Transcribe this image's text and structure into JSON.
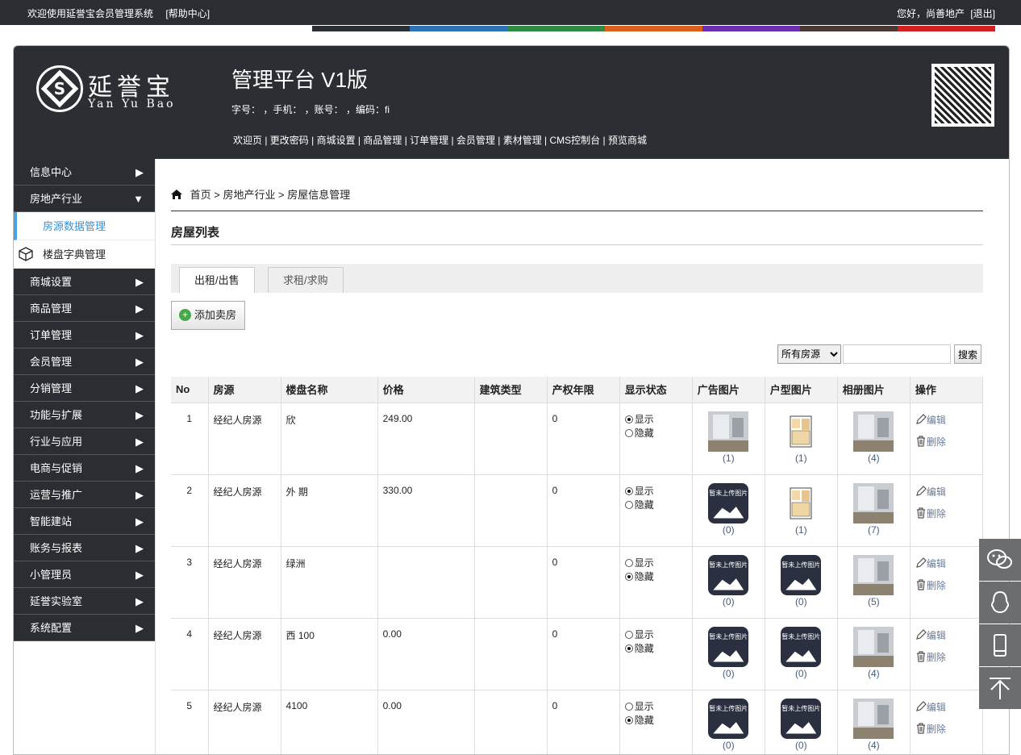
{
  "topbar": {
    "welcome": "欢迎使用延誉宝会员管理系统",
    "help": "[帮助中心]",
    "greeting": "您好，尚善地产",
    "logout": "[退出]"
  },
  "colorbar": [
    "#2a2e33",
    "#2d72b5",
    "#2f8a44",
    "#d9601a",
    "#6b2fb0",
    "#4a3a34",
    "#d32020"
  ],
  "header": {
    "logo_cn": "延誉宝",
    "logo_en": "Yan Yu Bao",
    "title": "管理平台  V1版",
    "info": "字号：       ，手机：          ，账号：                  ，编码：fi",
    "nav": "欢迎页 | 更改密码 | 商城设置 | 商品管理 | 订单管理 | 会员管理 | 素材管理 | CMS控制台 | 预览商城"
  },
  "sidebar": {
    "items": [
      {
        "label": "信息中心",
        "type": "menu",
        "arrow": "▶"
      },
      {
        "label": "房地产行业",
        "type": "menu",
        "arrow": "▼"
      },
      {
        "label": "房源数据管理",
        "type": "sub-active"
      },
      {
        "label": "楼盘字典管理",
        "type": "sub"
      },
      {
        "label": "商城设置",
        "type": "menu",
        "arrow": "▶"
      },
      {
        "label": "商品管理",
        "type": "menu",
        "arrow": "▶"
      },
      {
        "label": "订单管理",
        "type": "menu",
        "arrow": "▶"
      },
      {
        "label": "会员管理",
        "type": "menu",
        "arrow": "▶"
      },
      {
        "label": "分销管理",
        "type": "menu",
        "arrow": "▶"
      },
      {
        "label": "功能与扩展",
        "type": "menu",
        "arrow": "▶"
      },
      {
        "label": "行业与应用",
        "type": "menu",
        "arrow": "▶"
      },
      {
        "label": "电商与促销",
        "type": "menu",
        "arrow": "▶"
      },
      {
        "label": "运营与推广",
        "type": "menu",
        "arrow": "▶"
      },
      {
        "label": "智能建站",
        "type": "menu",
        "arrow": "▶"
      },
      {
        "label": "账务与报表",
        "type": "menu",
        "arrow": "▶"
      },
      {
        "label": "小管理员",
        "type": "menu",
        "arrow": "▶"
      },
      {
        "label": "延誉实验室",
        "type": "menu",
        "arrow": "▶"
      },
      {
        "label": "系统配置",
        "type": "menu",
        "arrow": "▶"
      }
    ]
  },
  "breadcrumb": "首页 > 房地产行业 > 房屋信息管理",
  "list_title": "房屋列表",
  "tabs": [
    "出租/出售",
    "求租/求购"
  ],
  "add_button": "添加卖房",
  "filter": {
    "select": "所有房源",
    "search_button": "搜索"
  },
  "table": {
    "headers": [
      "No",
      "房源",
      "楼盘名称",
      "价格",
      "建筑类型",
      "产权年限",
      "显示状态",
      "广告图片",
      "户型图片",
      "相册图片",
      "操作"
    ],
    "show_label": "显示",
    "hide_label": "隐藏",
    "edit_label": "编辑",
    "delete_label": "删除",
    "noimg_label": "暂未上传图片",
    "rows": [
      {
        "no": "1",
        "source": "经纪人房源",
        "name": "欣",
        "price": "249.00",
        "type": "",
        "years": "0",
        "show": true,
        "ad": {
          "img": "photo",
          "count": "(1)"
        },
        "plan": {
          "img": "plan",
          "count": "(1)"
        },
        "album": {
          "img": "photo",
          "count": "(4)"
        }
      },
      {
        "no": "2",
        "source": "经纪人房源",
        "name": "外              期",
        "price": "330.00",
        "type": "",
        "years": "0",
        "show": true,
        "ad": {
          "img": "none",
          "count": "(0)"
        },
        "plan": {
          "img": "plan",
          "count": "(1)"
        },
        "album": {
          "img": "photo",
          "count": "(7)"
        }
      },
      {
        "no": "3",
        "source": "经纪人房源",
        "name": "绿洲",
        "price": "",
        "type": "",
        "years": "0",
        "show": false,
        "ad": {
          "img": "none",
          "count": "(0)"
        },
        "plan": {
          "img": "none",
          "count": "(0)"
        },
        "album": {
          "img": "photo",
          "count": "(5)"
        }
      },
      {
        "no": "4",
        "source": "经纪人房源",
        "name": "西        100",
        "price": "0.00",
        "type": "",
        "years": "0",
        "show": false,
        "ad": {
          "img": "none",
          "count": "(0)"
        },
        "plan": {
          "img": "none",
          "count": "(0)"
        },
        "album": {
          "img": "photo",
          "count": "(4)"
        }
      },
      {
        "no": "5",
        "source": "经纪人房源",
        "name": "       4100",
        "price": "0.00",
        "type": "",
        "years": "0",
        "show": false,
        "ad": {
          "img": "none",
          "count": "(0)"
        },
        "plan": {
          "img": "none",
          "count": "(0)"
        },
        "album": {
          "img": "photo",
          "count": "(4)"
        }
      }
    ]
  }
}
